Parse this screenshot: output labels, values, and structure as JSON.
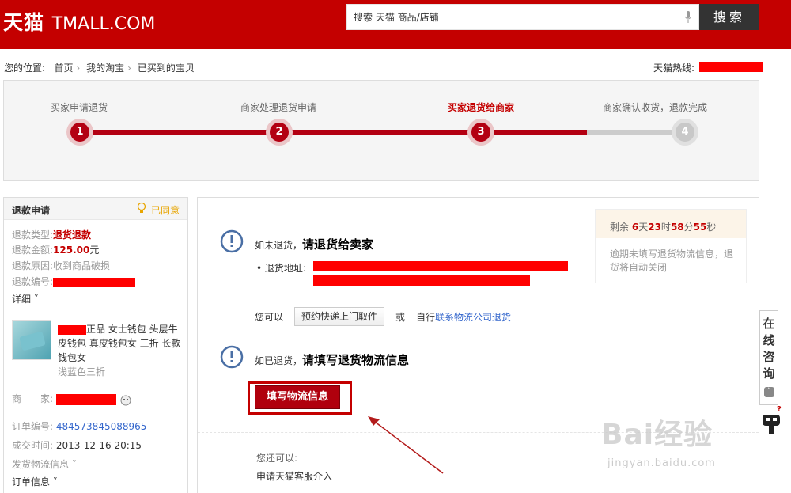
{
  "header": {
    "logo_cn": "天猫",
    "logo_en": "TMALL.COM",
    "search_value": "搜索 天猫 商品/店铺",
    "search_button": "搜索"
  },
  "breadcrumb": {
    "label": "您的位置:",
    "items": [
      "首页",
      "我的淘宝",
      "已买到的宝贝"
    ]
  },
  "hotline_label": "天猫热线:",
  "steps": [
    {
      "label": "买家申请退货",
      "num": "1"
    },
    {
      "label": "商家处理退货申请",
      "num": "2"
    },
    {
      "label": "买家退货给商家",
      "num": "3"
    },
    {
      "label": "商家确认收货，退款完成",
      "num": "4"
    }
  ],
  "colors": {
    "brand": "#c40000",
    "progress": "#b30012"
  },
  "refund": {
    "title": "退款申请",
    "status": "已同意",
    "type_label": "退款类型:",
    "type_value": "退货退款",
    "amount_label": "退款金额:",
    "amount_value": "125.00",
    "amount_unit": "元",
    "reason_label": "退款原因:",
    "reason_value": "收到商品破损",
    "id_label": "退款编号:",
    "detail_link": "详细",
    "product_title": "正品 女士钱包 头层牛皮钱包 真皮钱包女 三折 长款钱包女",
    "product_color": "浅蓝色三折",
    "seller_label": "商　　家:",
    "order_label": "订单编号:",
    "order_value": "484573845088965",
    "time_label": "成交时间:",
    "time_value": "2013-12-16 20:15",
    "shipping_info": "发货物流信息",
    "order_info": "订单信息"
  },
  "main": {
    "msg1_prefix": "如未退货，",
    "msg1_bold": "请退货给卖家",
    "address_label": "退货地址:",
    "you_can": "您可以",
    "pickup_button": "预约快递上门取件",
    "or": "或",
    "self_label": "自行",
    "self_link": "联系物流公司退货",
    "msg2_prefix": "如已退货，",
    "msg2_bold": "请填写退货物流信息",
    "fill_button": "填写物流信息",
    "also_label": "您还可以:",
    "apply_link": "申请天猫客服介入"
  },
  "countdown": {
    "prefix": "剩余",
    "days": "6",
    "days_unit": "天",
    "hours": "23",
    "hours_unit": "时",
    "minutes": "58",
    "minutes_unit": "分",
    "seconds": "55",
    "seconds_unit": "秒",
    "note": "逾期未填写退货物流信息，退货将自动关闭"
  },
  "chat_tab": [
    "在",
    "线",
    "咨",
    "询"
  ],
  "watermark": {
    "text": "Bai经验",
    "url": "jingyan.baidu.com"
  }
}
